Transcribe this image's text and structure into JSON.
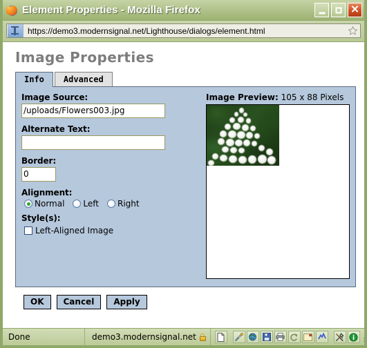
{
  "window": {
    "title": "Element Properties - Mozilla Firefox",
    "app_icon": "firefox-logo-icon",
    "controls": {
      "minimize_label": "_",
      "maximize_label": "□",
      "close_label": "✕"
    }
  },
  "urlbar": {
    "url": "https://demo3.modernsignal.net/Lighthouse/dialogs/element.html",
    "favicon": "site-favicon-icon",
    "bookmark_icon": "bookmark-star-icon"
  },
  "page": {
    "heading": "Image Properties",
    "tabs": [
      {
        "label": "Info",
        "active": true
      },
      {
        "label": "Advanced",
        "active": false
      }
    ],
    "form": {
      "image_source": {
        "label": "Image Source:",
        "value": "/uploads/Flowers003.jpg",
        "placeholder": ""
      },
      "alternate_text": {
        "label": "Alternate Text:",
        "value": "",
        "placeholder": ""
      },
      "border": {
        "label": "Border:",
        "value": "0",
        "placeholder": ""
      },
      "alignment": {
        "label": "Alignment:",
        "options": [
          {
            "label": "Normal",
            "selected": true
          },
          {
            "label": "Left",
            "selected": false
          },
          {
            "label": "Right",
            "selected": false
          }
        ]
      },
      "styles": {
        "label": "Style(s):",
        "options": [
          {
            "label": "Left-Aligned Image",
            "checked": false
          }
        ]
      }
    },
    "preview": {
      "label": "Image Preview:",
      "dimensions": "105 x 88 Pixels",
      "image_alt": "white-flowers-photo"
    },
    "buttons": {
      "ok": "OK",
      "cancel": "Cancel",
      "apply": "Apply"
    }
  },
  "statusbar": {
    "status": "Done",
    "domain": "demo3.modernsignal.net",
    "lock_icon": "padlock-icon",
    "icons": [
      "page-icon",
      "eyedropper-icon",
      "globe-icon",
      "save-icon",
      "print-icon",
      "refresh-icon",
      "note-icon",
      "lightning-icon",
      "tools-icon",
      "info-icon"
    ]
  },
  "colors": {
    "frame": "#8fa868",
    "titlebar": "#b5c691",
    "panel": "#b6c8dc",
    "tab_inactive": "#e2e2e2",
    "input_border": "#9a9a5e",
    "radio_dot": "#2faa2f",
    "close_button": "#cf4f24",
    "heading_text": "#7d7d7d"
  }
}
